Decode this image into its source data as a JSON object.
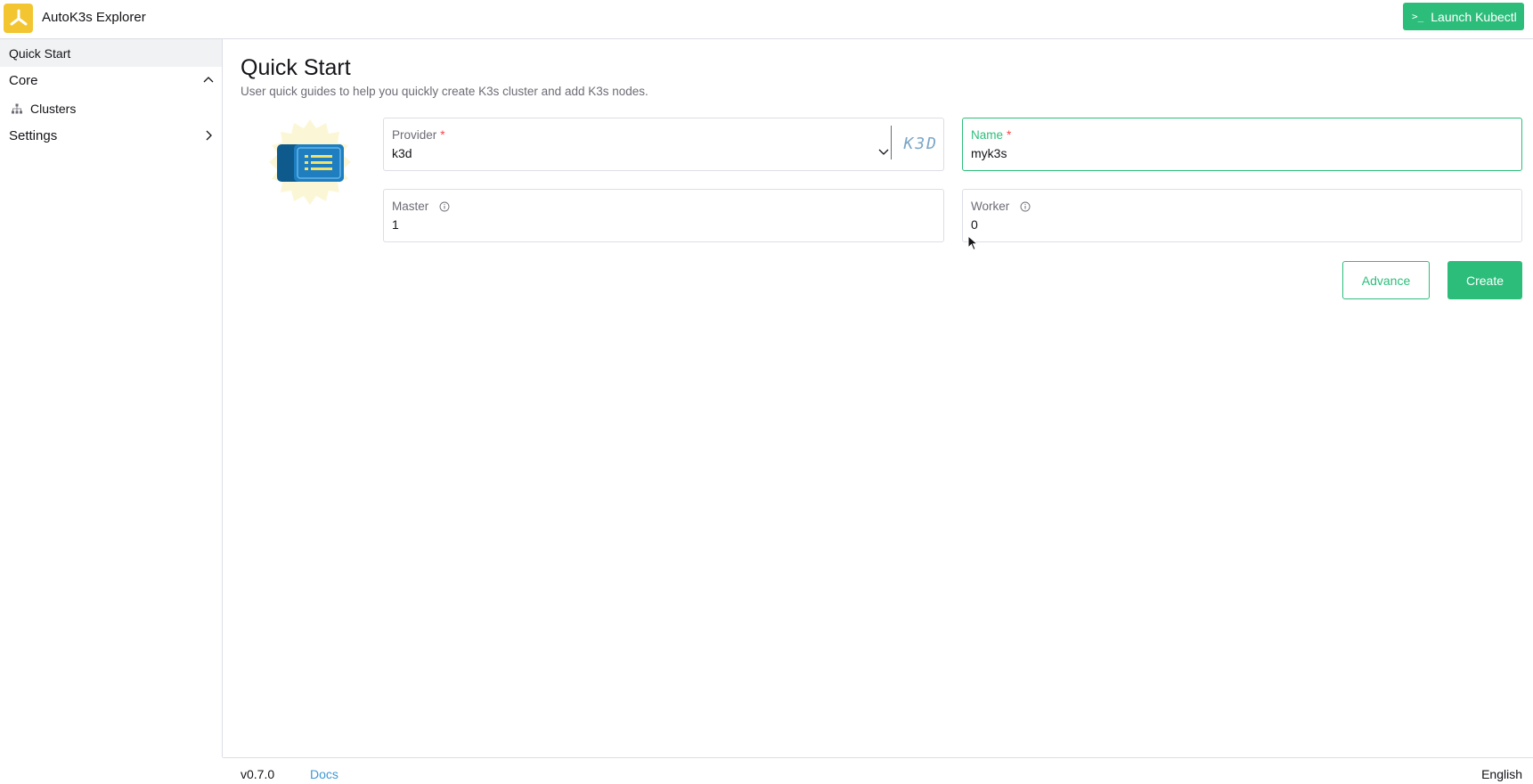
{
  "header": {
    "app_title": "AutoK3s Explorer",
    "kubectl_label": "Launch Kubectl",
    "kubectl_prompt": ">_"
  },
  "sidebar": {
    "items": [
      {
        "label": "Quick Start",
        "active": true
      },
      {
        "label": "Core",
        "expanded": true
      },
      {
        "label": "Clusters"
      },
      {
        "label": "Settings",
        "expanded": false
      }
    ]
  },
  "main": {
    "title": "Quick Start",
    "description": "User quick guides to help you quickly create K3s cluster and add K3s nodes.",
    "form": {
      "provider": {
        "label": "Provider",
        "required": "*",
        "value": "k3d",
        "logo_text": "K3D"
      },
      "name": {
        "label": "Name",
        "required": "*",
        "value": "myk3s"
      },
      "master": {
        "label": "Master",
        "value": "1"
      },
      "worker": {
        "label": "Worker",
        "value": "0"
      }
    },
    "buttons": {
      "advance": "Advance",
      "create": "Create"
    }
  },
  "footer": {
    "version": "v0.7.0",
    "docs": "Docs",
    "language": "English"
  },
  "colors": {
    "accent": "#2dbd7b",
    "logo": "#f2c531",
    "required": "#f64747",
    "link": "#3d98d3"
  }
}
